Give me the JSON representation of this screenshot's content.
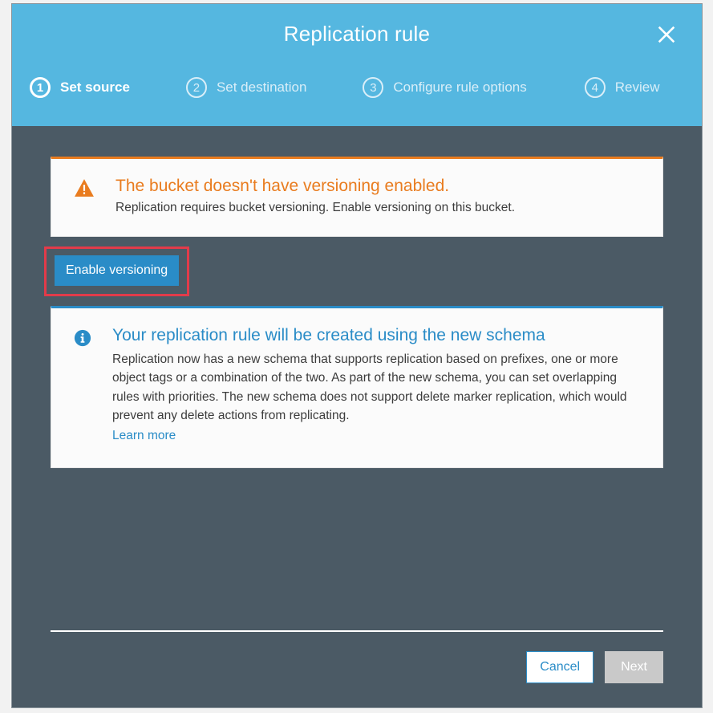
{
  "dialog": {
    "title": "Replication rule",
    "steps": [
      {
        "num": "1",
        "label": "Set source"
      },
      {
        "num": "2",
        "label": "Set destination"
      },
      {
        "num": "3",
        "label": "Configure rule options"
      },
      {
        "num": "4",
        "label": "Review"
      }
    ],
    "active_step_index": 0
  },
  "warning": {
    "title": "The bucket doesn't have versioning enabled.",
    "description": "Replication requires bucket versioning. Enable versioning on this bucket."
  },
  "enable_versioning_label": "Enable versioning",
  "info": {
    "title": "Your replication rule will be created using the new schema",
    "description": "Replication now has a new schema that supports replication based on prefixes, one or more object tags or a combination of the two. As part of the new schema, you can set overlapping rules with priorities. The new schema does not support delete marker replication, which would prevent any delete actions from replicating.",
    "learn_more": "Learn more"
  },
  "footer": {
    "cancel": "Cancel",
    "next": "Next"
  }
}
